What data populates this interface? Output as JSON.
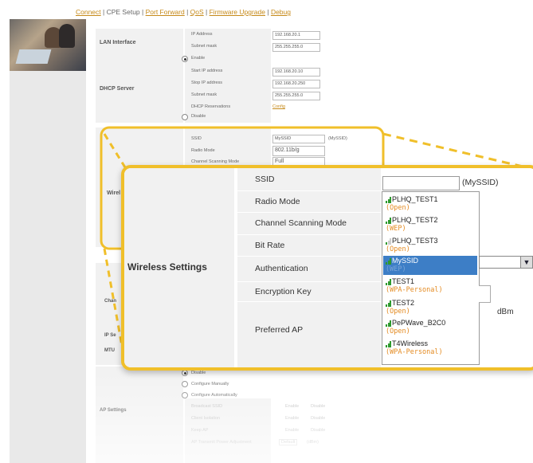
{
  "nav": {
    "items": [
      "Connect",
      "CPE Setup",
      "Port Forward",
      "QoS",
      "Firmware Upgrade",
      "Debug"
    ],
    "separator": " | "
  },
  "lan": {
    "section": "LAN Interface",
    "ip_label": "IP Address",
    "ip_value": "192.168.20.1",
    "mask_label": "Subnet mask",
    "mask_value": "255.255.255.0"
  },
  "dhcp": {
    "section": "DHCP Server",
    "enable": "Enable",
    "start_label": "Start IP address",
    "start_value": "192.168.20.10",
    "stop_label": "Stop IP address",
    "stop_value": "192.168.20.250",
    "mask_label": "Subnet mask",
    "mask_value": "255.255.255.0",
    "res_label": "DHCP Reservations",
    "res_link": "Config",
    "disable": "Disable"
  },
  "wireless_bg": {
    "ssid_label": "SSID",
    "ssid_value": "MySSID",
    "ssid_note": "(MySSID)",
    "radio_label": "Radio Mode",
    "radio_value": "802.11b/g",
    "scan_label": "Channel Scanning Mode",
    "scan_value": "Full",
    "section_partial": "Wirel"
  },
  "partial_labels": {
    "chan": "Chan",
    "ipse": "IP Se",
    "mtu": "MTU"
  },
  "ap": {
    "section": "AP Settings",
    "disable": "Disable",
    "manual": "Configure Manually",
    "auto": "Configure Automatically",
    "broadcast_label": "Broadcast SSID",
    "isolation_label": "Client Isolation",
    "keep_label": "Keep AP",
    "power_label": "AP Transmit Power Adjustment",
    "enable_opt": "Enable",
    "disable_opt": "Disable",
    "default_opt": "Default",
    "unit": "(dBm)"
  },
  "zoom": {
    "section": "Wireless Settings",
    "labels": [
      "SSID",
      "Radio Mode",
      "Channel Scanning Mode",
      "Bit Rate",
      "Authentication",
      "Encryption Key",
      "Preferred AP"
    ],
    "ssid_note": "(MySSID)",
    "dbm": "dBm",
    "networks": [
      {
        "name": "PLHQ_TEST1",
        "security": "(Open)",
        "selected": false,
        "weak": false
      },
      {
        "name": "PLHQ_TEST2",
        "security": "(WEP)",
        "selected": false,
        "weak": false
      },
      {
        "name": "PLHQ_TEST3",
        "security": "(Open)",
        "selected": false,
        "weak": true
      },
      {
        "name": "MySSID",
        "security": "(WEP)",
        "selected": true,
        "weak": false
      },
      {
        "name": "TEST1",
        "security": "(WPA-Personal)",
        "selected": false,
        "weak": false
      },
      {
        "name": "TEST2",
        "security": "(Open)",
        "selected": false,
        "weak": false
      },
      {
        "name": "PePWave_B2C0",
        "security": "(Open)",
        "selected": false,
        "weak": false
      },
      {
        "name": "T4Wireless",
        "security": "(WPA-Personal)",
        "selected": false,
        "weak": false
      }
    ]
  },
  "colors": {
    "accent_link": "#c68a1a",
    "highlight_border": "#f0bf2a",
    "selected_row": "#3d7ec6",
    "security_text": "#e48b22",
    "signal": "#2e9a2e"
  }
}
